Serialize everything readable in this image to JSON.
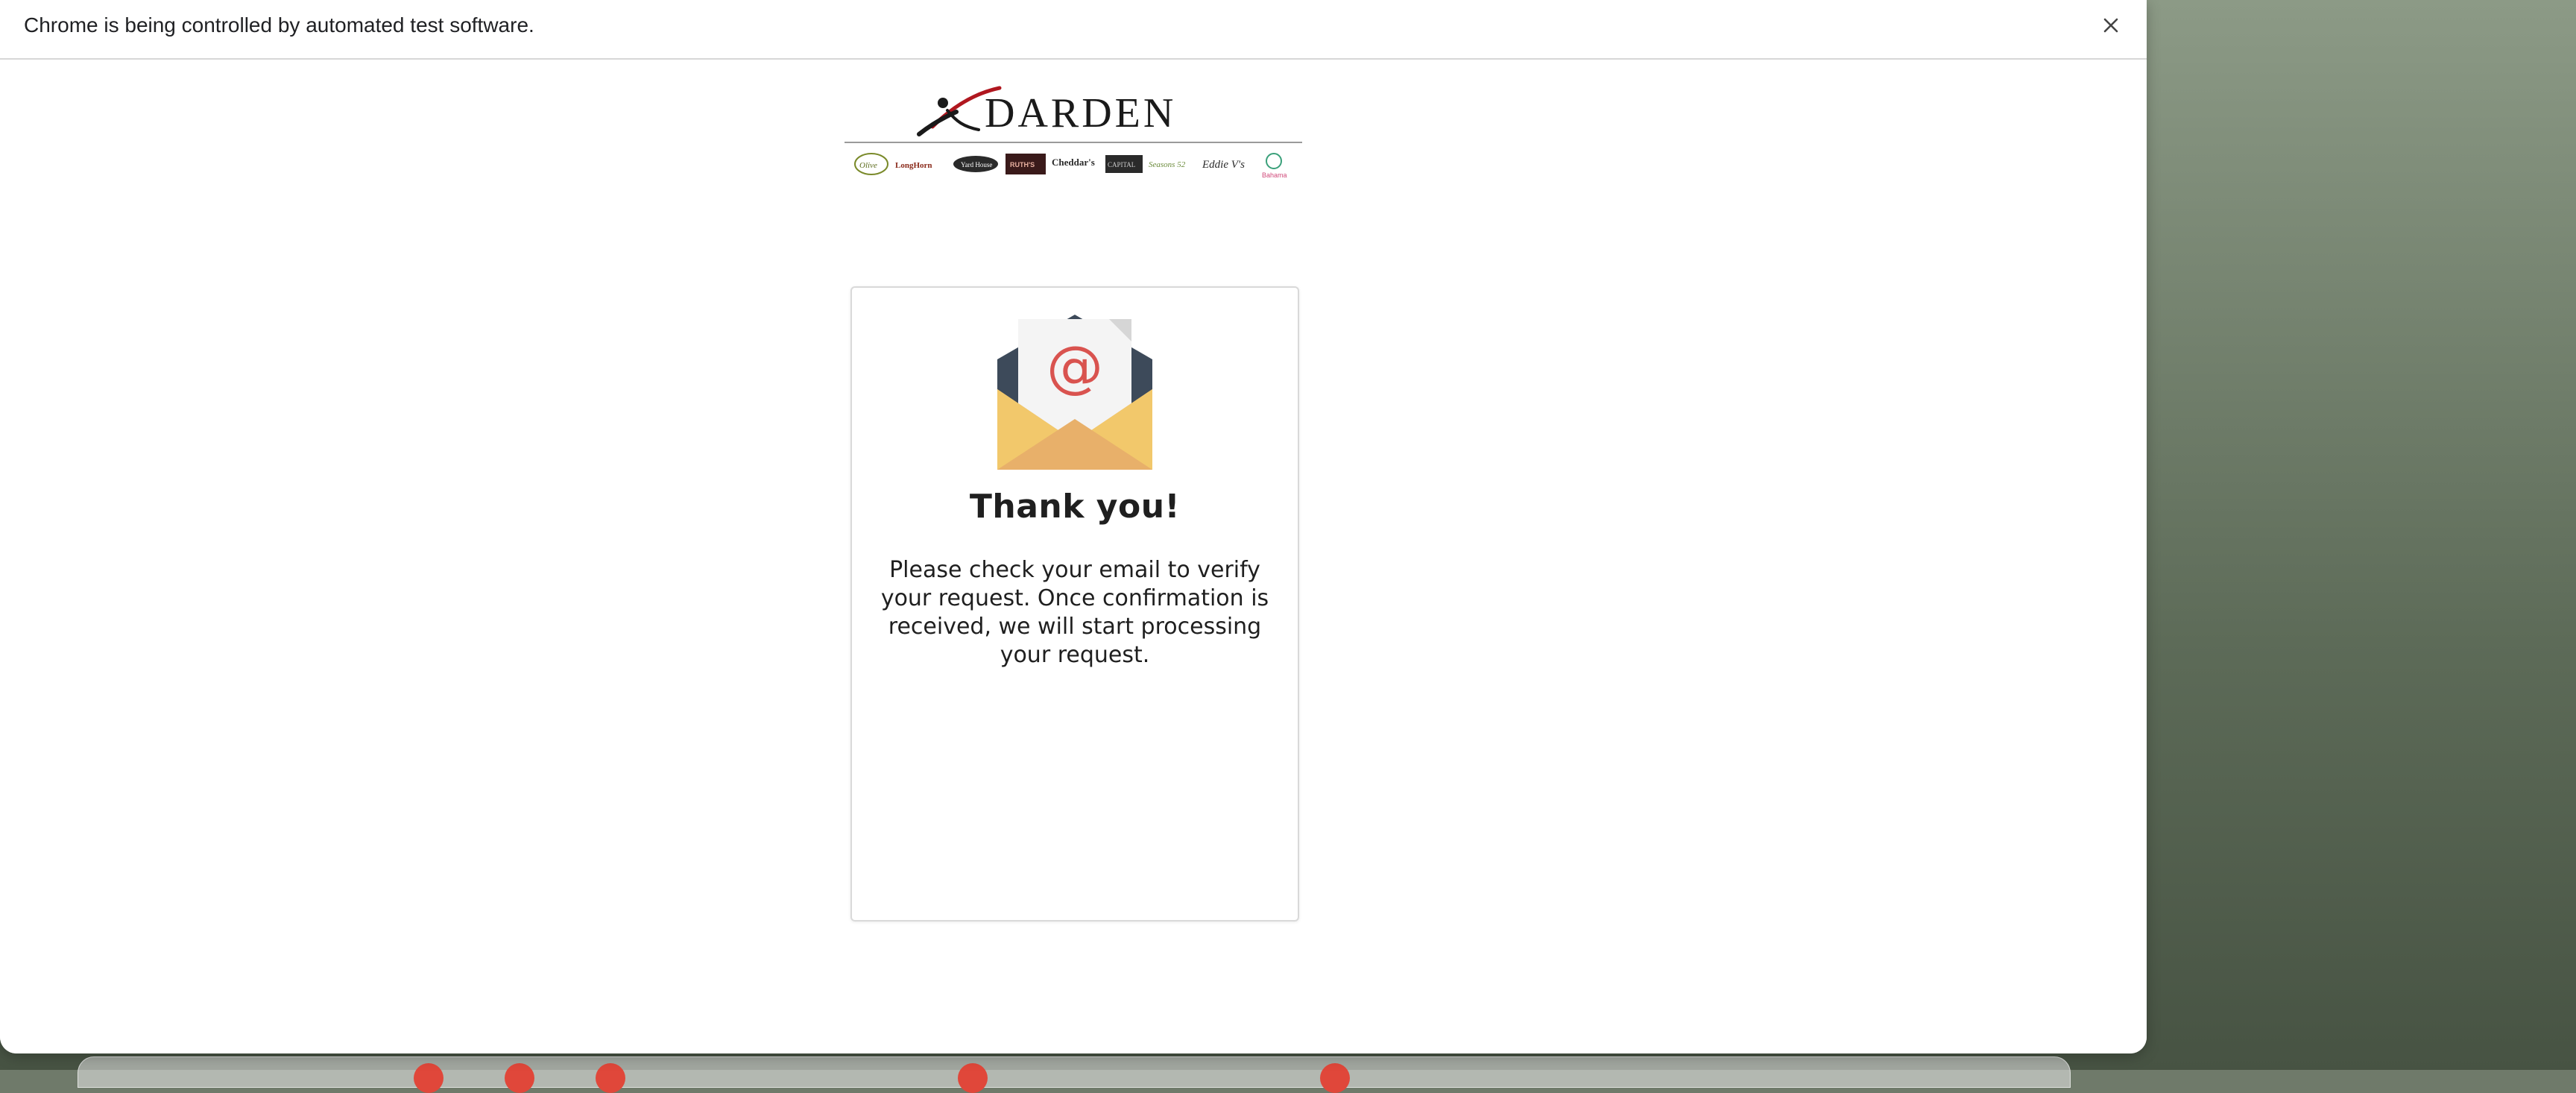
{
  "infobar": {
    "message": "Chrome is being controlled by automated test software.",
    "close_icon": "close-icon"
  },
  "header": {
    "logo_text": "DARDEN",
    "brands": [
      "Olive Garden",
      "LongHorn Steakhouse",
      "Yard House",
      "Ruth's Chris Steak House",
      "Cheddar's Scratch Kitchen",
      "The Capital Grille",
      "Seasons 52",
      "Eddie V's",
      "Bahama Breeze"
    ]
  },
  "card": {
    "icon": "email-envelope-icon",
    "title": "Thank you!",
    "message": "Please check your email to verify your request. Once confirmation is received, we will start processing your request."
  },
  "colors": {
    "envelope_body": "#f2c86b",
    "envelope_flap": "#e8b06a",
    "envelope_back": "#3d4a5a",
    "at_sign": "#d9534f",
    "logo_swoosh": "#b0171f"
  }
}
